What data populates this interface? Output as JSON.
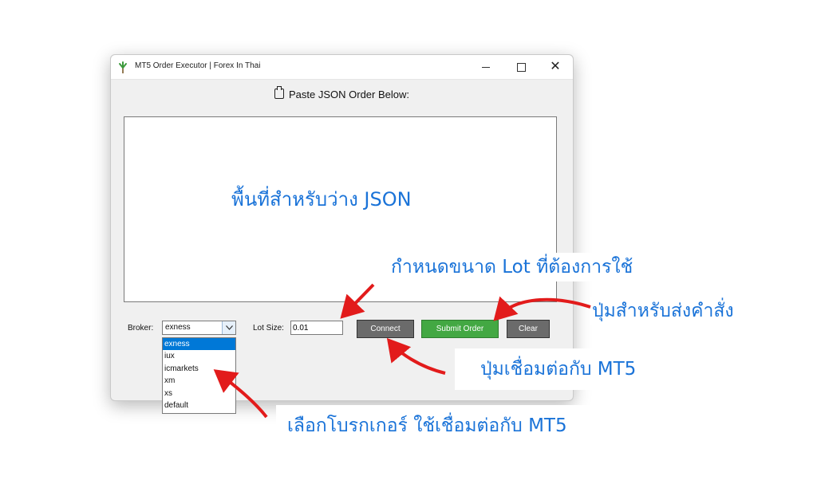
{
  "window": {
    "title": "MT5 Order Executor | Forex In Thai",
    "minimize_glyph": "",
    "close_glyph": "✕"
  },
  "header": {
    "label": "Paste JSON Order Below:",
    "icon": "clipboard-icon"
  },
  "json_input": {
    "value": ""
  },
  "broker": {
    "label": "Broker:",
    "selected": "exness",
    "options": [
      "exness",
      "iux",
      "icmarkets",
      "xm",
      "xs",
      "default"
    ]
  },
  "lot": {
    "label": "Lot Size:",
    "value": "0.01"
  },
  "buttons": {
    "connect": "Connect",
    "submit": "Submit Order",
    "clear": "Clear"
  },
  "annotations": {
    "json_area": "พื้นที่สำหรับว่าง JSON",
    "lot_size": "กำหนดขนาด Lot ที่ต้องการใช้",
    "submit": "ปุ่มสำหรับส่งคำสั่ง",
    "connect": "ปุ่มเชื่อมต่อกับ MT5",
    "broker": "เลือกโบรกเกอร์ ใช้เชื่อมต่อกับ MT5"
  },
  "colors": {
    "annotation_text": "#1a73d8",
    "arrow": "#e21b1b",
    "submit_button": "#43a843",
    "neutral_button": "#6b6b6b",
    "selection": "#0078d7"
  }
}
